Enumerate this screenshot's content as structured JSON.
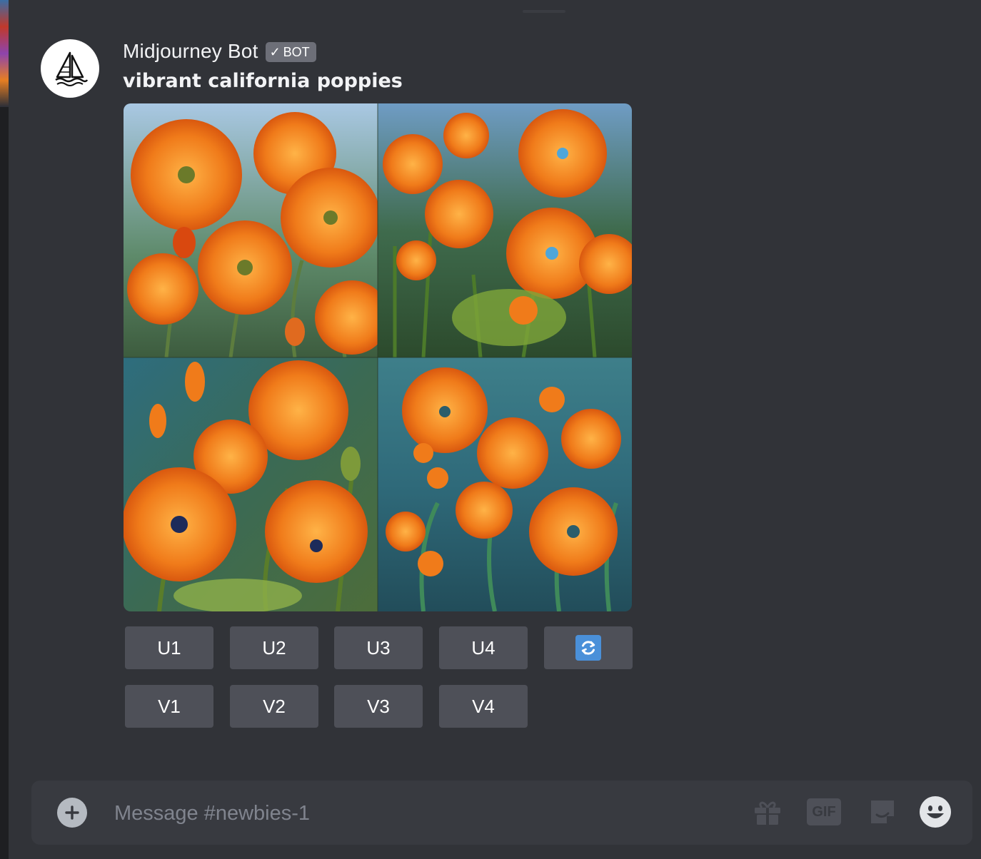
{
  "message": {
    "author": "Midjourney Bot",
    "badge": {
      "check": "✓",
      "label": "BOT"
    },
    "prompt": "vibrant california poppies",
    "avatar_icon": "sailboat-icon"
  },
  "image_grid": {
    "count": 4,
    "subject": "california-poppies-paintings"
  },
  "upscale_buttons": [
    {
      "label": "U1"
    },
    {
      "label": "U2"
    },
    {
      "label": "U3"
    },
    {
      "label": "U4"
    }
  ],
  "reroll_button": {
    "icon": "refresh-icon",
    "color": "#4a90d9"
  },
  "variation_buttons": [
    {
      "label": "V1"
    },
    {
      "label": "V2"
    },
    {
      "label": "V3"
    },
    {
      "label": "V4"
    }
  ],
  "composer": {
    "placeholder": "Message #newbies-1",
    "gif_label": "GIF",
    "icons": [
      "plus-icon",
      "gift-icon",
      "gif-icon",
      "sticker-icon",
      "emoji-icon"
    ]
  },
  "colors": {
    "background": "#313338",
    "button": "#4e5058",
    "composer": "#383a40",
    "poppy_orange": "#f07b1a"
  }
}
